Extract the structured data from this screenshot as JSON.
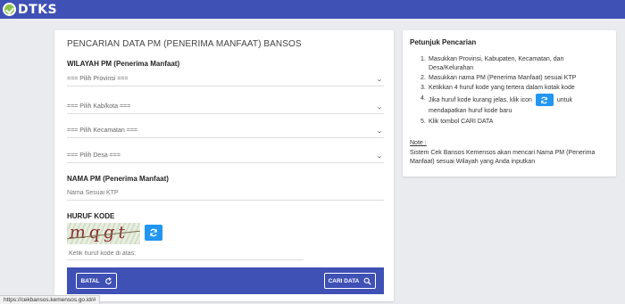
{
  "header": {
    "logo_text": "DTKS"
  },
  "form": {
    "title": "PENCARIAN DATA PM (PENERIMA MANFAAT) BANSOS",
    "wilayah_label": "WILAYAH PM (Penerima Manfaat)",
    "provinsi_selected": "=== Pilih Provinsi ===",
    "kabkota_selected": "=== Pilih Kab/kota ===",
    "kecamatan_selected": "=== Pilih Kecamatan ===",
    "desa_selected": "=== Pilih Desa ===",
    "nama_label": "NAMA PM (Penerima Manfaat)",
    "nama_placeholder": "Nama Sesuai KTP",
    "kode_label": "HURUF KODE",
    "captcha_text": "mqgt",
    "kode_placeholder": "Ketik huruf kode di atas:",
    "batal_label": "BATAL",
    "cari_label": "CARI DATA"
  },
  "help": {
    "title": "Petunjuk Pencarian",
    "steps": [
      "Masukkan Provinsi, Kabupaten, Kecamatan, dan Desa/Kelurahan",
      "Masukkan nama PM (Penerima Manfaat) sesuai KTP",
      "Ketikkan 4 huruf kode yang tertera dalam kotak kode",
      "Jika huruf kode kurang jelas, klik icon",
      "untuk",
      "mendapatkan huruf kode baru",
      "Klik tombol CARI DATA"
    ],
    "step_numbers": [
      "1.",
      "2.",
      "3.",
      "4.",
      "5."
    ],
    "note_label": "Note :",
    "note_text": "Sistem Cek Bansos Kemensos akan mencari Nama PM (Penerima Manfaat) sesuai Wilayah yang Anda inputkan"
  },
  "status": {
    "url": "https://cekbansos.kemensos.go.id/#"
  },
  "colors": {
    "primary": "#3f51b5",
    "accent": "#2196f3",
    "logo_green": "#8bc34a"
  },
  "icons": {
    "refresh": "refresh-icon",
    "search": "search-icon",
    "dropdown": "chevron-down-icon"
  }
}
